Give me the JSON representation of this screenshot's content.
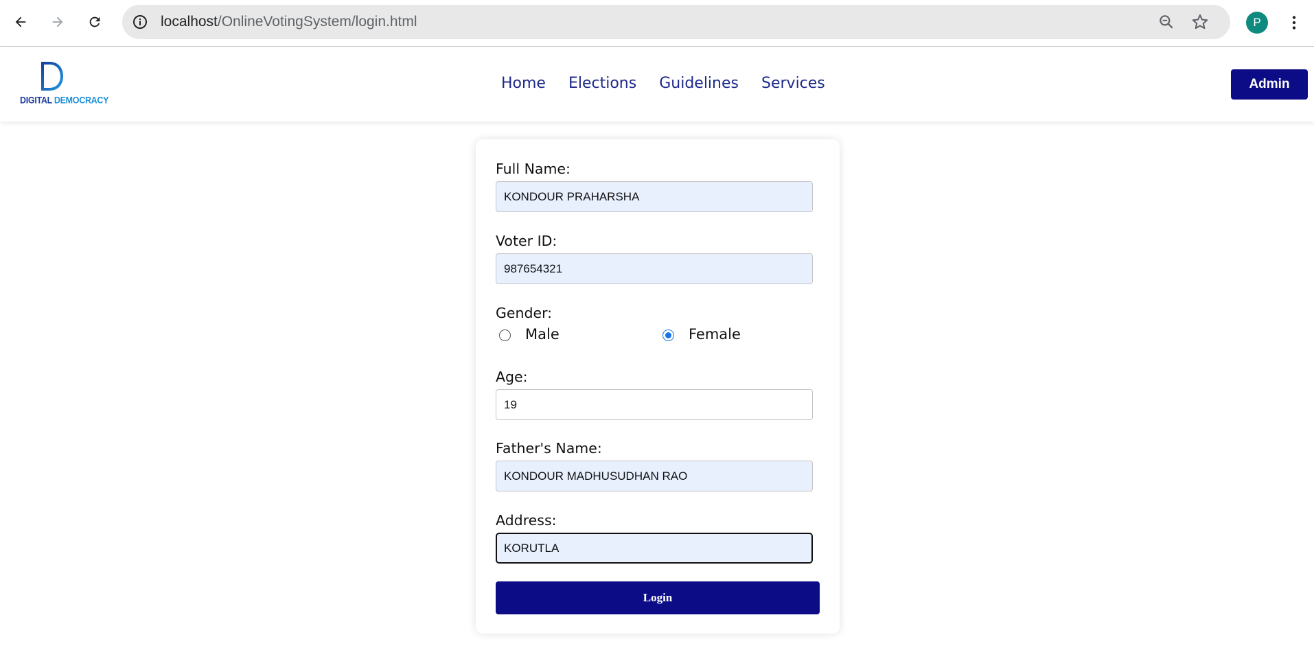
{
  "browser": {
    "url_host": "localhost",
    "url_path": "/OnlineVotingSystem/login.html",
    "profile_initial": "P",
    "icons": [
      "back-icon",
      "forward-icon",
      "reload-icon",
      "site-info-icon",
      "zoom-icon",
      "bookmark-star-icon",
      "menu-kebab-icon"
    ]
  },
  "header": {
    "logo_line1": "DIGITAL ",
    "logo_line2": "DEMOCRACY",
    "nav": [
      "Home",
      "Elections",
      "Guidelines",
      "Services"
    ],
    "admin_label": "Admin"
  },
  "form": {
    "full_name_label": "Full Name:",
    "full_name_value": "KONDOUR PRAHARSHA",
    "voter_id_label": "Voter ID:",
    "voter_id_value": "987654321",
    "gender_label": "Gender:",
    "gender_options": [
      "Male",
      "Female"
    ],
    "gender_selected": "Female",
    "age_label": "Age:",
    "age_value": "19",
    "father_label": "Father's Name:",
    "father_value": "KONDOUR MADHUSUDHAN RAO",
    "address_label": "Address:",
    "address_value": "KORUTLA",
    "submit_label": "Login"
  },
  "colors": {
    "primary": "#0c0c87",
    "nav_link": "#1e2a8a",
    "autofill_bg": "#e8f0fe",
    "radio_accent": "#1a73e8"
  }
}
